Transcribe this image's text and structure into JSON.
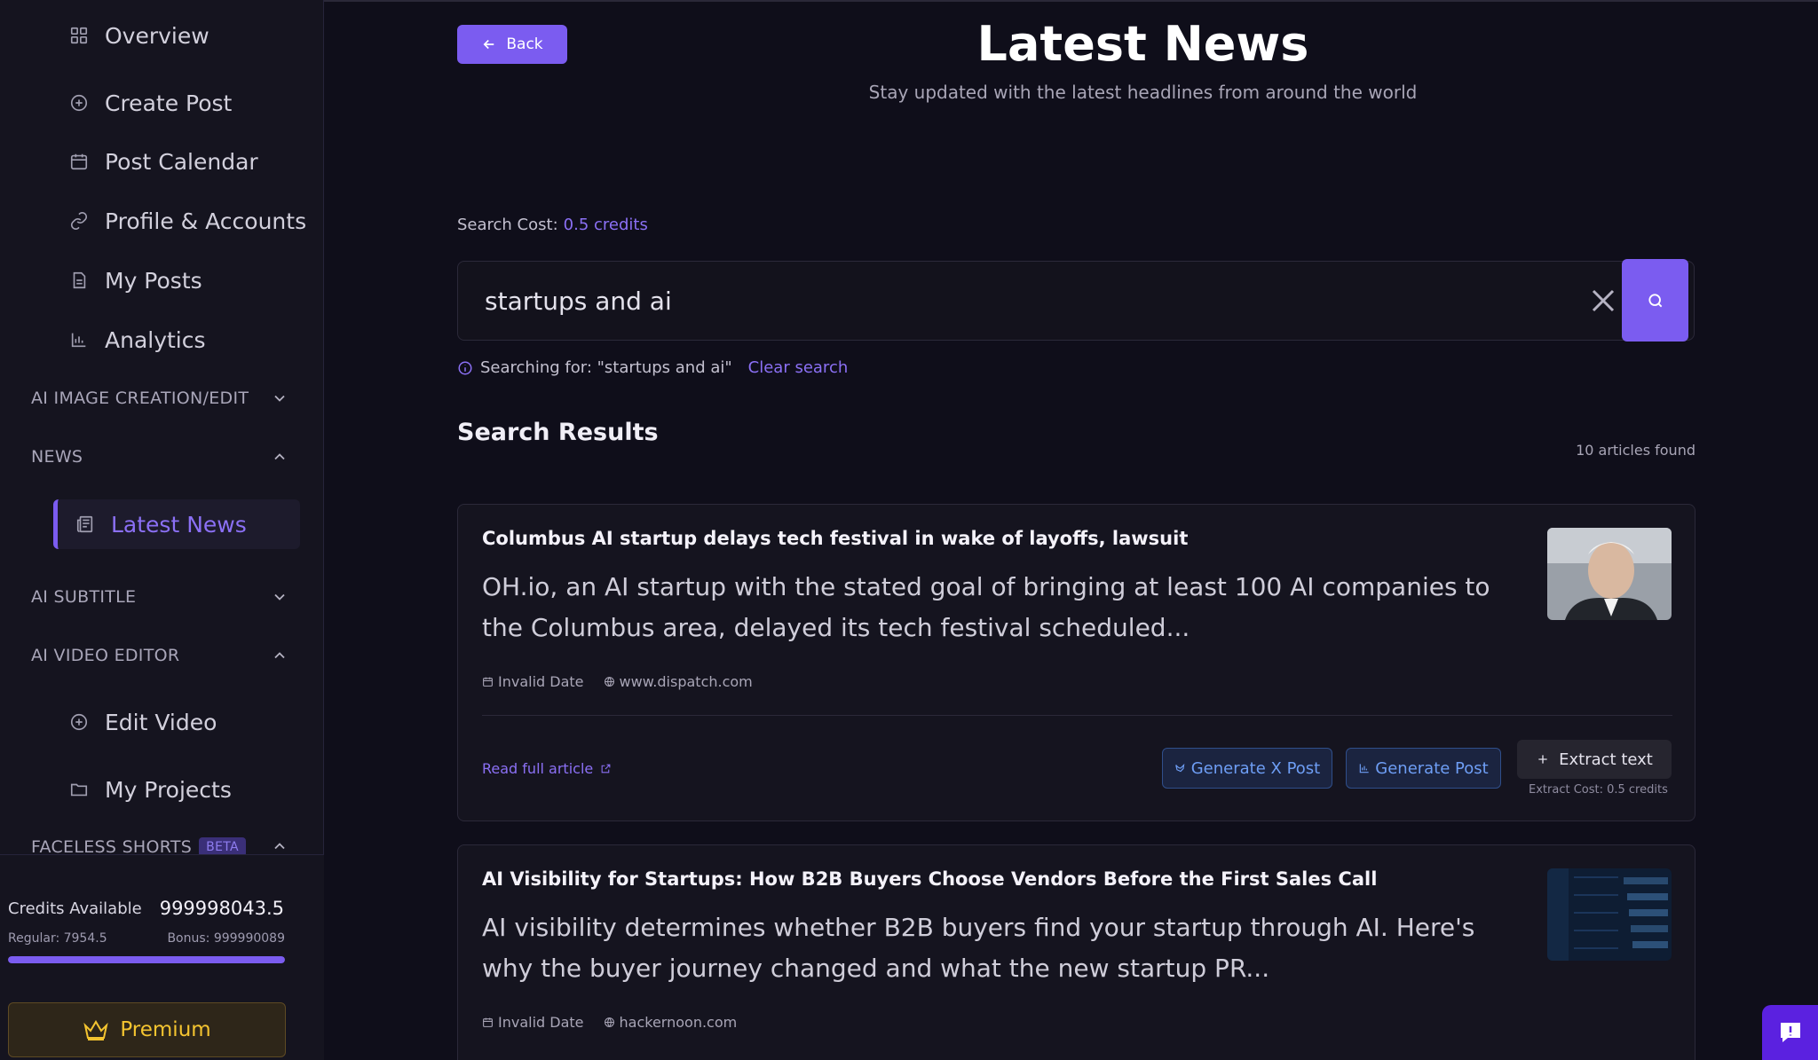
{
  "sidebar": {
    "items": [
      {
        "label": "Overview",
        "icon": "grid-icon"
      },
      {
        "label": "Create Post",
        "icon": "plus-circle-icon"
      },
      {
        "label": "Post Calendar",
        "icon": "calendar-icon"
      },
      {
        "label": "Profile & Accounts",
        "icon": "link-icon"
      },
      {
        "label": "My Posts",
        "icon": "document-icon"
      },
      {
        "label": "Analytics",
        "icon": "bar-chart-icon"
      }
    ],
    "sections": {
      "ai_image": "AI IMAGE CREATION/EDIT",
      "news": "NEWS",
      "ai_subtitle": "AI SUBTITLE",
      "ai_video": "AI VIDEO EDITOR",
      "faceless": "FACELESS SHORTS",
      "beta": "BETA"
    },
    "news_items": [
      {
        "label": "Latest News",
        "icon": "newspaper-icon"
      }
    ],
    "video_items": [
      {
        "label": "Edit Video",
        "icon": "plus-circle-icon"
      },
      {
        "label": "My Projects",
        "icon": "folder-icon"
      }
    ],
    "credits": {
      "title": "Credits Available",
      "value": "999998043.5",
      "regular": "Regular: 7954.5",
      "bonus": "Bonus: 999990089",
      "fill_fraction": 1.0
    },
    "premium_label": "Premium"
  },
  "header": {
    "back_label": "Back",
    "title": "Latest News",
    "subtitle": "Stay updated with the latest headlines from around the world"
  },
  "search": {
    "cost_label": "Search Cost:",
    "cost_value": "0.5 credits",
    "query": "startups and ai",
    "searching_text": "Searching for: \"startups and ai\"",
    "clear_label": "Clear search"
  },
  "results": {
    "title": "Search Results",
    "count": "10 articles found",
    "articles": [
      {
        "title": "Columbus AI startup delays tech festival in wake of layoffs, lawsuit",
        "description": "OH.io, an AI startup with the stated goal of bringing at least 100 AI companies to the Columbus area, delayed its tech festival scheduled...",
        "date": "Invalid Date",
        "source": "www.dispatch.com",
        "read_label": "Read full article",
        "gen_x_label": "Generate X Post",
        "gen_post_label": "Generate Post",
        "extract_label": "Extract text",
        "extract_cost": "Extract Cost: 0.5 credits"
      },
      {
        "title": "AI Visibility for Startups: How B2B Buyers Choose Vendors Before the First Sales Call",
        "description": "AI visibility determines whether B2B buyers find your startup through AI. Here's why the buyer journey changed and what the new startup PR...",
        "date": "Invalid Date",
        "source": "hackernoon.com"
      }
    ]
  },
  "colors": {
    "accent": "#7b5cf0",
    "background": "#0f0e1a",
    "sidebar": "#15141f",
    "premium": "#f4c430"
  }
}
